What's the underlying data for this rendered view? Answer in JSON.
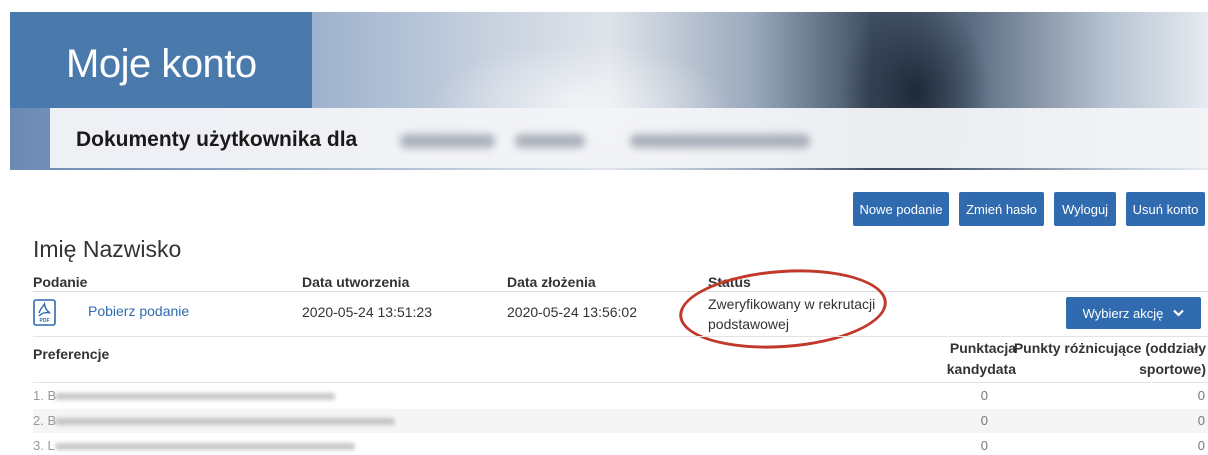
{
  "header": {
    "title": "Moje konto",
    "subtitle": "Dokumenty użytkownika dla"
  },
  "actions": {
    "new_application": "Nowe podanie",
    "change_password": "Zmień hasło",
    "logout": "Wyloguj",
    "delete_account": "Usuń konto"
  },
  "user": {
    "name": "Imię Nazwisko"
  },
  "table": {
    "headers": {
      "application": "Podanie",
      "created": "Data utworzenia",
      "submitted": "Data złożenia",
      "status": "Status"
    },
    "row": {
      "link": "Pobierz podanie",
      "created": "2020-05-24 13:51:23",
      "submitted": "2020-05-24 13:56:02",
      "status": "Zweryfikowany w rekrutacji podstawowej",
      "action_button": "Wybierz akcję"
    }
  },
  "preferences": {
    "header": "Preferencje",
    "points_header_1": "Punktacja",
    "points_header_2": "kandydata",
    "diff_header_1": "Punkty różnicujące (oddziały",
    "diff_header_2": "sportowe)",
    "rows": [
      {
        "num": "1. B",
        "points": "0",
        "diff": "0"
      },
      {
        "num": "2. B",
        "points": "0",
        "diff": "0"
      },
      {
        "num": "3. L",
        "points": "0",
        "diff": "0"
      }
    ]
  },
  "icons": {
    "pdf": "pdf-icon",
    "chevron": "chevron-down-icon"
  },
  "colors": {
    "primary": "#2f6bae",
    "banner_title_bg": "#4a7aab",
    "highlight": "#c0392b"
  }
}
